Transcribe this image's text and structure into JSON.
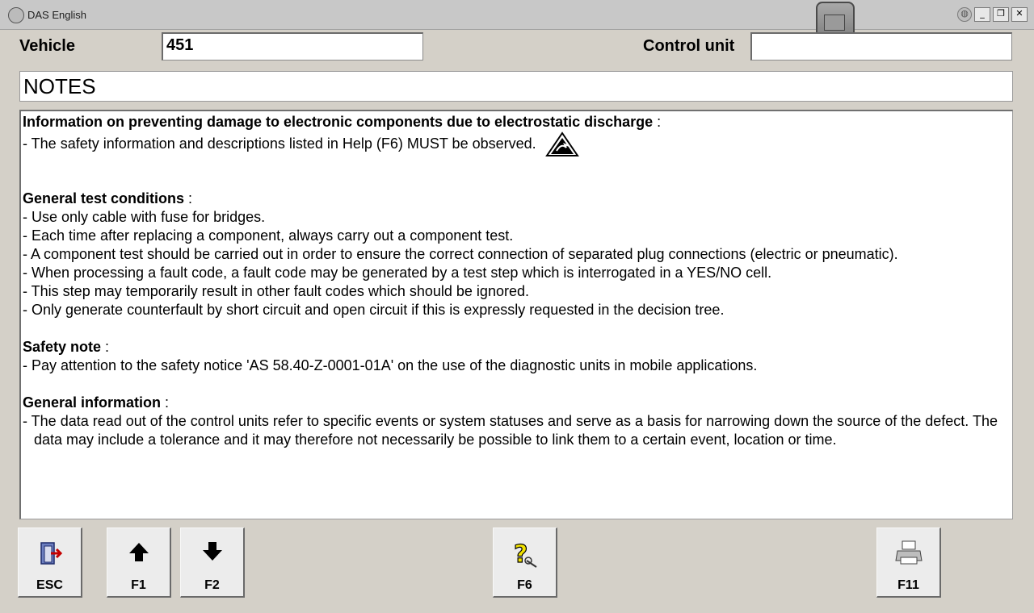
{
  "window": {
    "title": "DAS English"
  },
  "vehicle": {
    "label": "Vehicle",
    "value": "451"
  },
  "control_unit": {
    "label": "Control unit",
    "value": ""
  },
  "notes_title": "NOTES",
  "notes": {
    "esd_heading": "Information on preventing damage to electronic components due to electrostatic discharge",
    "esd_line": "- The safety information and descriptions listed in Help (F6) MUST be observed.",
    "general_test_heading": "General test conditions",
    "general_test_lines": [
      "- Use only cable with fuse for bridges.",
      "- Each time after replacing a component, always carry out a component test.",
      "- A component test should be carried out in order to ensure the correct connection of separated plug connections (electric or pneumatic).",
      "- When processing a fault code, a fault code may be generated by a test step which is interrogated in a YES/NO cell.",
      "- This step may temporarily result in other fault codes which should be ignored.",
      "- Only generate counterfault by short circuit and open circuit if this is expressly requested in the decision tree."
    ],
    "safety_heading": "Safety note",
    "safety_line": "- Pay attention to the safety notice 'AS 58.40-Z-0001-01A' on the use of the diagnostic units in mobile applications.",
    "general_info_heading": "General information",
    "general_info_line": "- The data read out of the control units refer to specific events or system statuses and serve as a basis for narrowing down the source of the defect. The data may include a tolerance and it may therefore not necessarily be possible to link them to a certain event, location or time.",
    "colon": " :"
  },
  "fkeys": {
    "esc": "ESC",
    "f1": "F1",
    "f2": "F2",
    "f6": "F6",
    "f11": "F11"
  }
}
